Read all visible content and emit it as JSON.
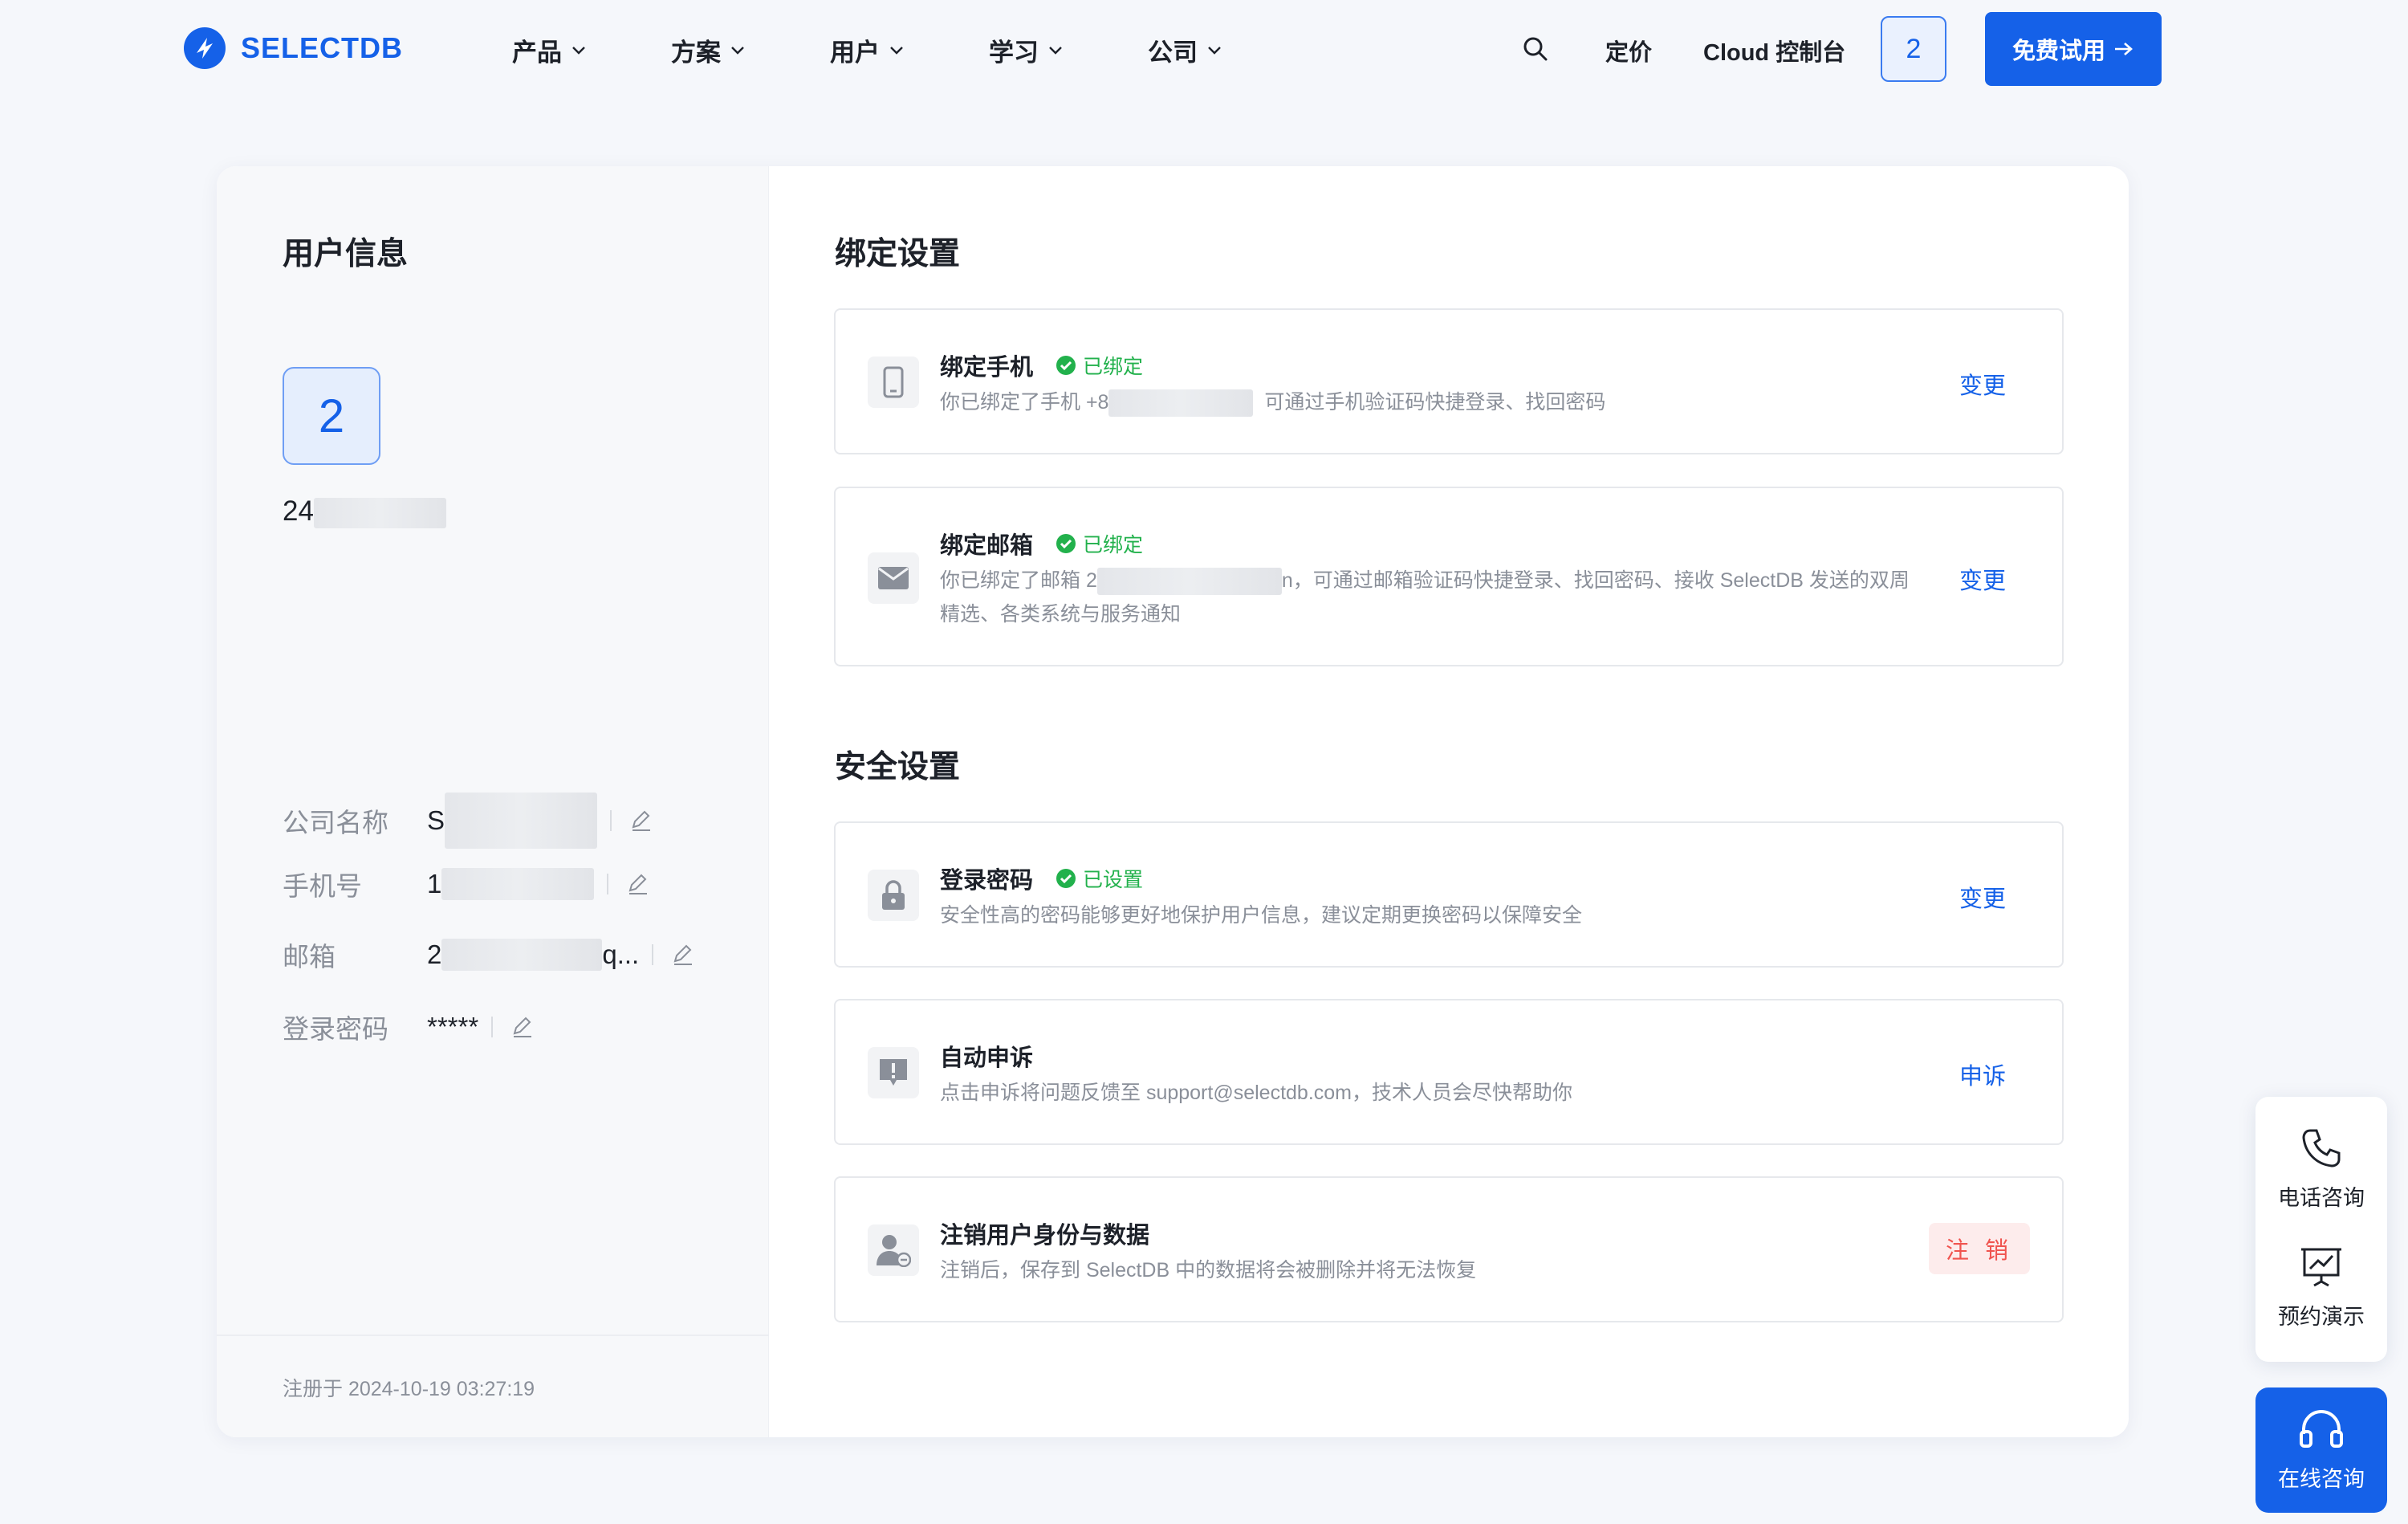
{
  "nav": {
    "brand": "SELECTDB",
    "menu": [
      {
        "label": "产品"
      },
      {
        "label": "方案"
      },
      {
        "label": "用户"
      },
      {
        "label": "学习"
      },
      {
        "label": "公司"
      }
    ],
    "pricing": "定价",
    "console": "Cloud 控制台",
    "avatar": "2",
    "trial": "免费试用",
    "icons": {
      "search": "search-icon",
      "arrow": "arrow-right-icon",
      "chevron": "chevron-down-icon"
    }
  },
  "user": {
    "title": "用户信息",
    "avatar": "2",
    "username_prefix": "24",
    "fields": [
      {
        "key": "公司名称",
        "value_prefix": "S",
        "value_suffix": ""
      },
      {
        "key": "手机号",
        "value_prefix": "1",
        "value_suffix": ""
      },
      {
        "key": "邮箱",
        "value_prefix": "2",
        "value_suffix": "q..."
      },
      {
        "key": "登录密码",
        "value_prefix": "*****",
        "value_suffix": ""
      }
    ],
    "registered": "注册于 2024-10-19 03:27:19"
  },
  "binding": {
    "title": "绑定设置",
    "phone": {
      "title": "绑定手机",
      "status": "已绑定",
      "desc_prefix": "你已绑定了手机 +8",
      "desc_suffix": "可通过手机验证码快捷登录、找回密码",
      "action": "变更"
    },
    "email": {
      "title": "绑定邮箱",
      "status": "已绑定",
      "desc_prefix": "你已绑定了邮箱 2",
      "desc_suffix": "n，可通过邮箱验证码快捷登录、找回密码、接收 SelectDB 发送的双周精选、各类系统与服务通知",
      "action": "变更"
    }
  },
  "security": {
    "title": "安全设置",
    "password": {
      "title": "登录密码",
      "status": "已设置",
      "desc": "安全性高的密码能够更好地保护用户信息，建议定期更换密码以保障安全",
      "action": "变更"
    },
    "appeal": {
      "title": "自动申诉",
      "desc": "点击申诉将问题反馈至 support@selectdb.com，技术人员会尽快帮助你",
      "action": "申诉"
    },
    "deactivate": {
      "title": "注销用户身份与数据",
      "desc": "注销后，保存到 SelectDB 中的数据将会被删除并将无法恢复",
      "action": "注 销"
    }
  },
  "float": {
    "phone": "电话咨询",
    "demo": "预约演示",
    "online": "在线咨询"
  },
  "colors": {
    "brand": "#1561e8",
    "success": "#22b14c",
    "danger": "#f0544f"
  }
}
